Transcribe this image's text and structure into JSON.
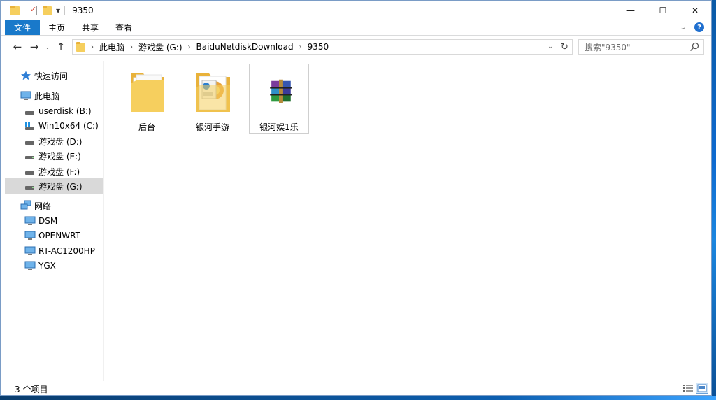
{
  "window": {
    "title": "9350",
    "caption": {
      "minimize": "—",
      "maximize": "☐",
      "close": "✕"
    }
  },
  "ribbon": {
    "file_tab": "文件",
    "tabs": [
      "主页",
      "共享",
      "查看"
    ],
    "expand_glyph": "⌄",
    "help_glyph": "?"
  },
  "nav": {
    "back": "←",
    "forward": "→",
    "recent": "⌄",
    "up": "↑",
    "breadcrumb": [
      "此电脑",
      "游戏盘 (G:)",
      "BaiduNetdiskDownload",
      "9350"
    ],
    "crumb_separator": "›",
    "refresh_glyph": "↻",
    "dropdown_glyph": "⌄",
    "search_placeholder": "搜索\"9350\""
  },
  "sidebar": {
    "quick_access": "快速访问",
    "this_pc": "此电脑",
    "drives": [
      {
        "label": "userdisk (B:)",
        "icon": "drive-icon"
      },
      {
        "label": "Win10x64 (C:)",
        "icon": "system-drive-icon"
      },
      {
        "label": "游戏盘 (D:)",
        "icon": "drive-icon"
      },
      {
        "label": "游戏盘 (E:)",
        "icon": "drive-icon"
      },
      {
        "label": "游戏盘 (F:)",
        "icon": "drive-icon"
      },
      {
        "label": "游戏盘 (G:)",
        "icon": "drive-icon",
        "selected": true
      }
    ],
    "network": "网络",
    "network_items": [
      "DSM",
      "OPENWRT",
      "RT-AC1200HP",
      "YGX"
    ]
  },
  "files": [
    {
      "name": "后台",
      "icon": "folder-icon"
    },
    {
      "name": "银河手游",
      "icon": "folder-with-doc-icon"
    },
    {
      "name": "银河娱1乐",
      "icon": "winrar-archive-icon"
    }
  ],
  "status": {
    "item_count": "3 个项目"
  },
  "colors": {
    "file_tab_bg": "#1979ca",
    "folder": "#f6cf5e",
    "selected_bg": "#d9d9d9"
  }
}
